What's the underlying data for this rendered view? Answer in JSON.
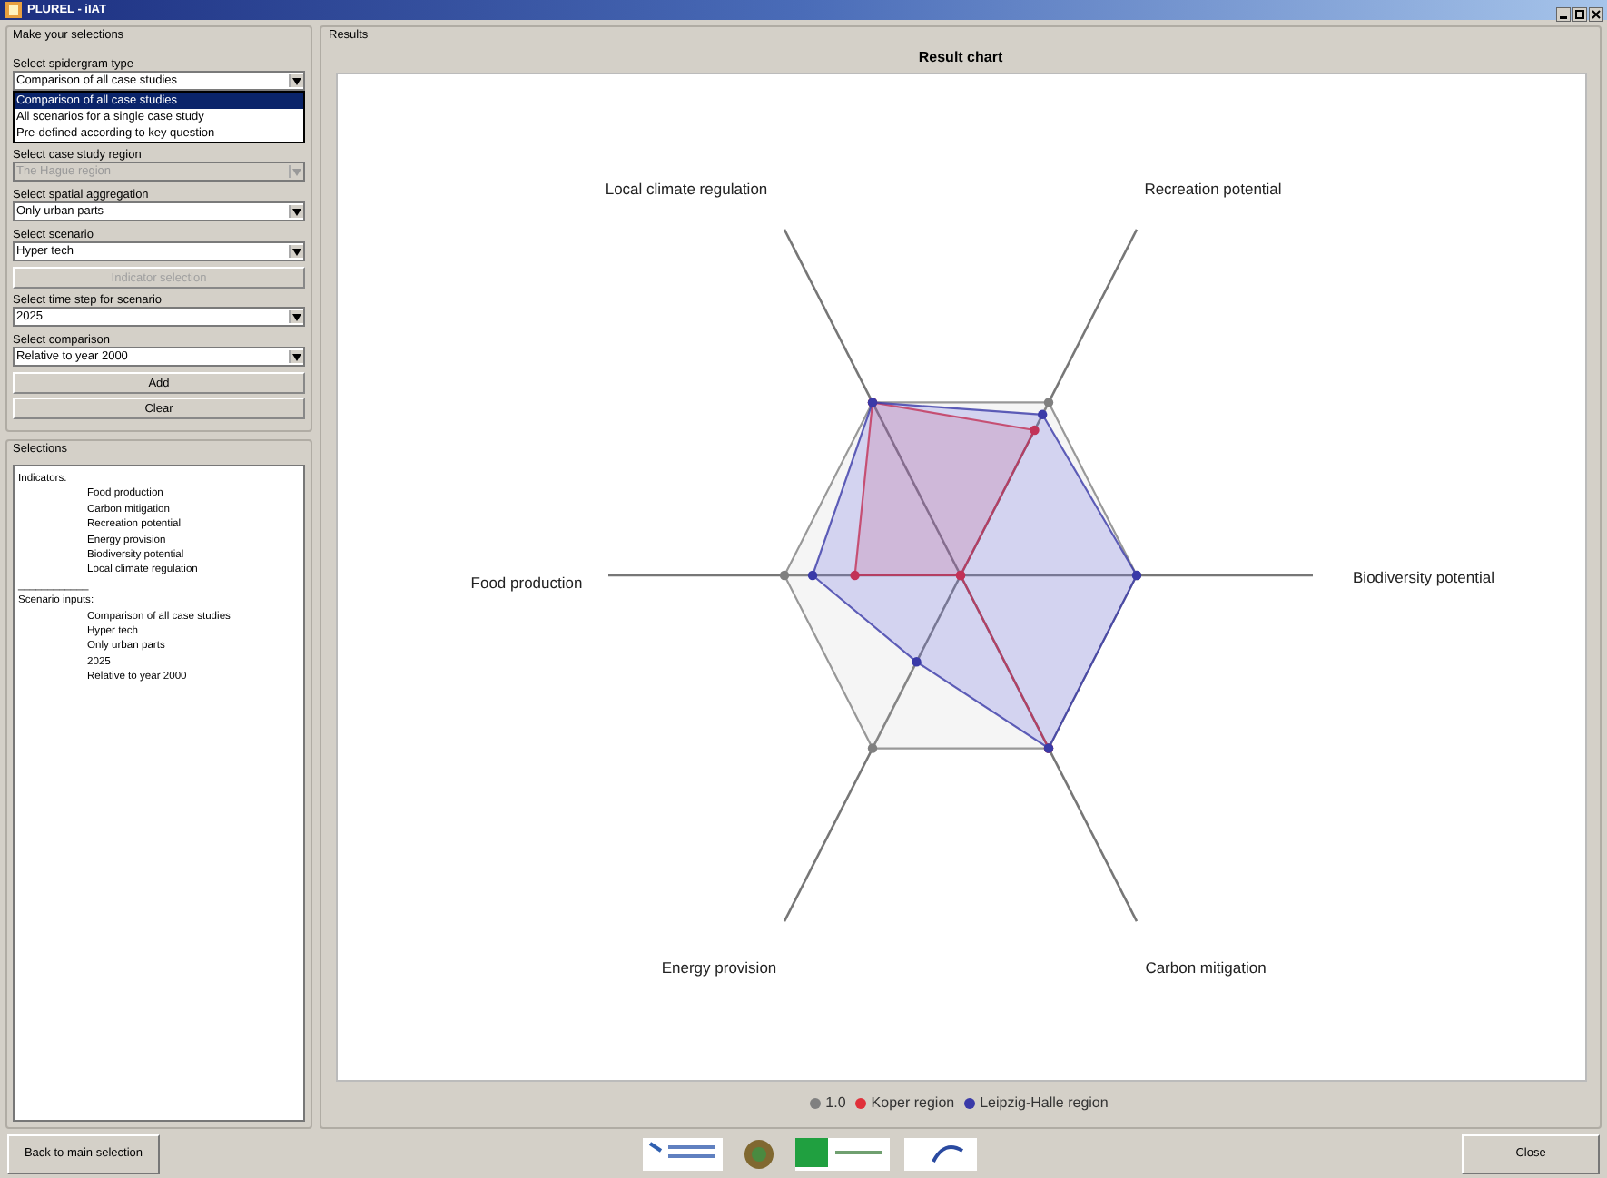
{
  "window": {
    "title": "PLUREL - iIAT"
  },
  "selections_panel": {
    "title": "Make your selections",
    "fields": [
      {
        "kind": "combo",
        "label": "Select spidergram type",
        "value": "Comparison of all case studies",
        "disabled": false,
        "expanded": true,
        "options": [
          {
            "label": "Comparison of all case studies",
            "selected": true
          },
          {
            "label": "All scenarios for a single case study",
            "selected": false
          },
          {
            "label": "Pre-defined according to key question",
            "selected": false
          }
        ]
      },
      {
        "kind": "combo",
        "label": "Select case study region",
        "value": "The Hague region",
        "disabled": true,
        "expanded": false
      },
      {
        "kind": "combo",
        "label": "Select spatial aggregation",
        "value": "Only urban parts",
        "disabled": false,
        "expanded": false
      },
      {
        "kind": "combo",
        "label": "Select scenario",
        "value": "Hyper tech",
        "disabled": false,
        "expanded": false
      },
      {
        "kind": "button",
        "label": "Indicator selection",
        "disabled": true
      },
      {
        "kind": "combo",
        "label": "Select time step for scenario",
        "value": "2025",
        "disabled": false,
        "expanded": false
      },
      {
        "kind": "combo",
        "label": "Select comparison",
        "value": "Relative to year 2000",
        "disabled": false,
        "expanded": false
      },
      {
        "kind": "button",
        "label": "Add",
        "disabled": false
      },
      {
        "kind": "button",
        "label": "Clear",
        "disabled": false
      }
    ]
  },
  "selections": {
    "title": "Selections",
    "lines": [
      {
        "text": "Indicators:",
        "children": [
          {
            "text": "Food production"
          },
          {
            "text": "Carbon mitigation"
          },
          {
            "text": "Recreation potential"
          },
          {
            "text": "Energy provision"
          },
          {
            "text": "Biodiversity potential"
          },
          {
            "text": "Local climate regulation"
          }
        ]
      },
      {
        "text": "____________"
      },
      {
        "text": "Scenario inputs:",
        "children": [
          {
            "text": "Comparison of all case studies"
          },
          {
            "text": "Hyper tech"
          },
          {
            "text": "Only urban parts"
          },
          {
            "text": "2025"
          },
          {
            "text": "Relative to year 2000"
          }
        ]
      }
    ]
  },
  "results": {
    "title": "Results",
    "chart_title": "Result chart",
    "axes": [
      "Local climate regulation",
      "Recreation potential",
      "Food production",
      "Biodiversity potential",
      "Energy provision",
      "Carbon mitigation"
    ],
    "legend": [
      {
        "label": "1.0",
        "color": "#808080"
      },
      {
        "label": "Koper region",
        "color": "#e0303a"
      },
      {
        "label": "Leipzig-Halle region",
        "color": "#3a3aa8"
      }
    ]
  },
  "buttons": {
    "back": "Back to main selection",
    "close": "Close"
  }
}
